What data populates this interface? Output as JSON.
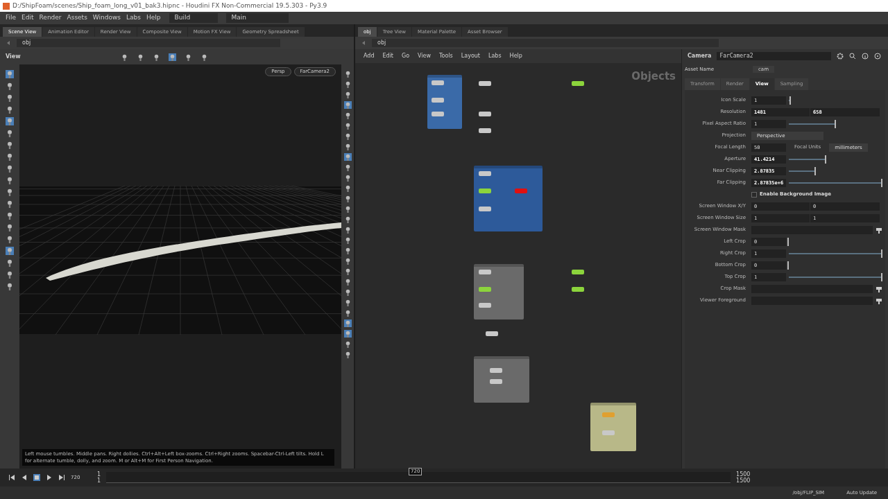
{
  "window": {
    "title": "D:/ShipFoam/scenes/Ship_foam_long_v01_bak3.hipnc - Houdini FX Non-Commercial 19.5.303 - Py3.9"
  },
  "menu_bar": {
    "items": [
      "File",
      "Edit",
      "Render",
      "Assets",
      "Windows",
      "Labs",
      "Help"
    ],
    "desktop": "Build",
    "context": "Main"
  },
  "left_pane": {
    "tabs": [
      {
        "label": "Scene View",
        "selected": true
      },
      {
        "label": "Animation Editor",
        "selected": false
      },
      {
        "label": "Render View",
        "selected": false
      },
      {
        "label": "Composite View",
        "selected": false
      },
      {
        "label": "Motion FX View",
        "selected": false
      },
      {
        "label": "Geometry Spreadsheet",
        "selected": false
      }
    ],
    "path": "obj",
    "view_label": "View",
    "camera_buttons": [
      "Persp",
      "FarCamera2"
    ],
    "hint": "Left mouse tumbles. Middle pans. Right dollies. Ctrl+Alt+Left box-zooms. Ctrl+Right zooms. Spacebar-Ctrl-Left tilts. Hold L for alternate tumble, dolly, and zoom.    M or Alt+M for First Person Navigation."
  },
  "right_pane": {
    "tabs": [
      {
        "label": "obj",
        "selected": true
      },
      {
        "label": "Tree View",
        "selected": false
      },
      {
        "label": "Material Palette",
        "selected": false
      },
      {
        "label": "Asset Browser",
        "selected": false
      }
    ],
    "path": "obj",
    "menu": [
      "Add",
      "Edit",
      "Go",
      "View",
      "Tools",
      "Layout",
      "Labs",
      "Help"
    ],
    "context_label": "Objects",
    "network_boxes": [
      {
        "color": "#3a6aa8"
      },
      {
        "color": "#2d5a9a"
      },
      {
        "color": "#6a6a6a"
      },
      {
        "color": "#6a6a6a"
      },
      {
        "color": "#b8b888"
      }
    ],
    "nodes": [
      {
        "color": "#c8c8c8"
      },
      {
        "color": "#c8c8c8"
      },
      {
        "color": "#c8c8c8"
      },
      {
        "color": "#c8c8c8"
      },
      {
        "color": "#c8c8c8"
      },
      {
        "color": "#c8c8c8"
      },
      {
        "color": "#8cd43c"
      },
      {
        "color": "#c8c8c8"
      },
      {
        "color": "#8cd43c"
      },
      {
        "color": "#e01010"
      },
      {
        "color": "#c8c8c8"
      },
      {
        "color": "#c8c8c8"
      },
      {
        "color": "#8cd43c"
      },
      {
        "color": "#c8c8c8"
      },
      {
        "color": "#8cd43c"
      },
      {
        "color": "#8cd43c"
      },
      {
        "color": "#c8c8c8"
      },
      {
        "color": "#c8c8c8"
      },
      {
        "color": "#c8c8c8"
      },
      {
        "color": "#e0a030"
      },
      {
        "color": "#c8c8c8"
      }
    ]
  },
  "parameters": {
    "type": "Camera",
    "name": "FarCamera2",
    "asset_name_label": "Asset Name",
    "asset_name": "cam",
    "tabs": [
      {
        "label": "Transform",
        "selected": false
      },
      {
        "label": "Render",
        "selected": false
      },
      {
        "label": "View",
        "selected": true
      },
      {
        "label": "Sampling",
        "selected": false
      }
    ],
    "rows": [
      {
        "kind": "slider",
        "label": "Icon Scale",
        "value": "1",
        "level": 0.02
      },
      {
        "kind": "vec2",
        "label": "Resolution",
        "values": [
          "1481",
          "658"
        ],
        "bold": true
      },
      {
        "kind": "slider",
        "label": "Pixel Aspect Ratio",
        "value": "1",
        "level": 0.5
      },
      {
        "kind": "menu",
        "label": "Projection",
        "value": "Perspective"
      },
      {
        "kind": "focal",
        "label": "Focal Length",
        "value": "50",
        "label2": "Focal Units",
        "value2": "millimeters"
      },
      {
        "kind": "slider",
        "label": "Aperture",
        "value": "41.4214",
        "level": 0.4,
        "bold": true
      },
      {
        "kind": "slider",
        "label": "Near Clipping",
        "value": "2.87835",
        "level": 0.29,
        "bold": true
      },
      {
        "kind": "slider",
        "label": "Far Clipping",
        "value": "2.87835e+6",
        "level": 1,
        "bold": true
      },
      {
        "kind": "checkbox",
        "label": "Enable Background Image",
        "checked": false
      },
      {
        "kind": "vec2",
        "label": "Screen Window X/Y",
        "values": [
          "0",
          "0"
        ]
      },
      {
        "kind": "vec2",
        "label": "Screen Window Size",
        "values": [
          "1",
          "1"
        ]
      },
      {
        "kind": "file",
        "label": "Screen Window Mask"
      },
      {
        "kind": "slider",
        "label": "Left Crop",
        "value": "0",
        "level": 0
      },
      {
        "kind": "slider",
        "label": "Right Crop",
        "value": "1",
        "level": 1
      },
      {
        "kind": "slider",
        "label": "Bottom Crop",
        "value": "0",
        "level": 0
      },
      {
        "kind": "slider",
        "label": "Top Crop",
        "value": "1",
        "level": 1
      },
      {
        "kind": "file",
        "label": "Crop Mask"
      },
      {
        "kind": "filemenu",
        "label": "Viewer Foreground"
      }
    ]
  },
  "timeline": {
    "frame": "720",
    "start": "1",
    "range_start": "1",
    "marker": "720",
    "end": "1500",
    "range_end": "1500"
  },
  "status_bar": {
    "path": "/obj/FLIP_SIM",
    "update": "Auto Update"
  }
}
